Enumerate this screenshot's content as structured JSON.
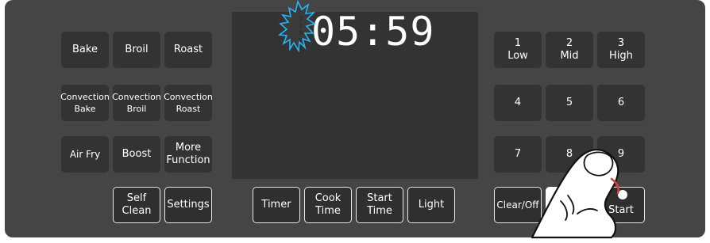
{
  "display": {
    "timer_indicator": "TIMER",
    "clock": "05:59"
  },
  "cook_modes": [
    {
      "label": "Bake"
    },
    {
      "label": "Broil"
    },
    {
      "label": "Roast"
    },
    {
      "label": "Convection\nBake"
    },
    {
      "label": "Convection\nBroil"
    },
    {
      "label": "Convection\nRoast"
    },
    {
      "label": "Air Fry"
    },
    {
      "label": "Boost"
    },
    {
      "label": "More\nFunction"
    }
  ],
  "bottom_left": [
    {
      "label": "Self\nClean"
    },
    {
      "label": "Settings"
    }
  ],
  "bottom_center": [
    {
      "label": "Timer"
    },
    {
      "label": "Cook\nTime"
    },
    {
      "label": "Start\nTime"
    },
    {
      "label": "Light"
    }
  ],
  "keypad": [
    {
      "label": "1\nLow"
    },
    {
      "label": "2\nMid"
    },
    {
      "label": "3\nHigh"
    },
    {
      "label": "4"
    },
    {
      "label": "5"
    },
    {
      "label": "6"
    },
    {
      "label": "7"
    },
    {
      "label": "8"
    },
    {
      "label": "9"
    }
  ],
  "bottom_right": [
    {
      "label": "Clear/Off"
    },
    {
      "label": "0"
    },
    {
      "label": "Start"
    }
  ],
  "icons": {
    "burst": "timer-alert-burst-icon",
    "finger": "pressing-finger-icon",
    "indicator": "start-indicator-light-icon"
  },
  "colors": {
    "panel": "#454545",
    "button": "#333333",
    "burst_glow": "#29b6f6",
    "indicator": "#e53935"
  }
}
